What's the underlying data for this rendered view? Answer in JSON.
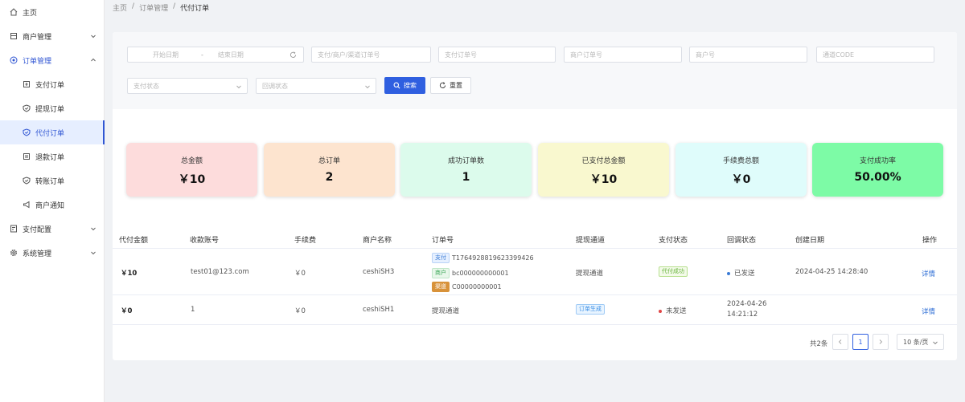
{
  "sidebar": {
    "items": [
      {
        "label": "主页",
        "icon": "home-icon"
      },
      {
        "label": "商户管理",
        "icon": "building-icon"
      },
      {
        "label": "订单管理",
        "icon": "order-icon"
      },
      {
        "label": "支付订单",
        "icon": "pay-order-icon"
      },
      {
        "label": "提现订单",
        "icon": "withdraw-icon"
      },
      {
        "label": "代付订单",
        "icon": "shield-icon"
      },
      {
        "label": "退款订单",
        "icon": "refund-icon"
      },
      {
        "label": "转账订单",
        "icon": "transfer-icon"
      },
      {
        "label": "商户通知",
        "icon": "megaphone-icon"
      },
      {
        "label": "支付配置",
        "icon": "config-icon"
      },
      {
        "label": "系统管理",
        "icon": "gear-icon"
      }
    ]
  },
  "breadcrumb": [
    "主页",
    "订单管理",
    "代付订单"
  ],
  "filters": {
    "start_date": "开始日期",
    "end_date": "结束日期",
    "order_search": "支付/商户/渠道订单号",
    "pay_order_no": "支付订单号",
    "merchant_order_no": "商户订单号",
    "merchant_no": "商户号",
    "channel_code": "通道CODE",
    "pay_status": "支付状态",
    "callback_status": "回调状态",
    "search_label": "搜索",
    "reset_label": "重置"
  },
  "stats": [
    {
      "title": "总金额",
      "value": "￥10",
      "color": "#fddcdc"
    },
    {
      "title": "总订单",
      "value": "2",
      "color": "#fde4cf"
    },
    {
      "title": "成功订单数",
      "value": "1",
      "color": "#dcfbec"
    },
    {
      "title": "已支付总金额",
      "value": "￥10",
      "color": "#f9f8cf"
    },
    {
      "title": "手续费总额",
      "value": "￥0",
      "color": "#dffcfb"
    },
    {
      "title": "支付成功率",
      "value": "50.00%",
      "color": "#7dfba6"
    }
  ],
  "table": {
    "headers": [
      "代付金额",
      "收款账号",
      "手续费",
      "商户名称",
      "订单号",
      "提现通道",
      "支付状态",
      "回调状态",
      "创建日期",
      "操作"
    ],
    "rows": [
      {
        "amount": "￥10",
        "account": "test01@123.com",
        "fee": "￥0",
        "merchant": "ceshiSH3",
        "order_tags": [
          {
            "tag": "支付",
            "value": "T1764928819623399426"
          },
          {
            "tag": "商户",
            "value": "bc000000000001"
          },
          {
            "tag": "渠道",
            "value": "C00000000001"
          }
        ],
        "channel": "提现通道",
        "pay_status": "代付成功",
        "callback_status": "已发送",
        "callback_color": "#3a7bd5",
        "created": "2024-04-25 14:28:40",
        "action": "详情"
      },
      {
        "amount": "￥0",
        "account": "1",
        "fee": "￥0",
        "merchant": "ceshiSH1",
        "order_text": "提现通道",
        "pay_status": "订单生成",
        "callback_status": "未发送",
        "callback_color": "#e04646",
        "created_date": "2024-04-26",
        "created_time": "14:21:12",
        "action": "详情"
      }
    ]
  },
  "pagination": {
    "total": "共2条",
    "page": "1",
    "page_size": "10 条/页"
  }
}
